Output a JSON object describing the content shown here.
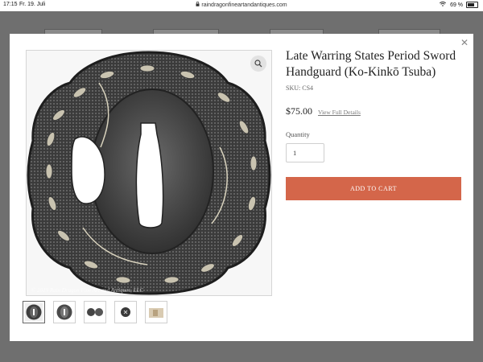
{
  "statusbar": {
    "time": "17:15",
    "date": "Fr. 19. Juli",
    "url": "raindragonfineartandantiques.com",
    "battery": "69 %"
  },
  "product": {
    "title": "Late Warring States Period Sword Handguard (Ko-Kinkō Tsuba)",
    "sku": "SKU: CS4",
    "price": "$75.00",
    "full_details_link": "View Full Details",
    "quantity_label": "Quantity",
    "quantity_value": "1",
    "add_to_cart": "ADD TO CART",
    "watermark": "© 2019 Rain Dragon Fine Art and Antiques, LLC"
  },
  "colors": {
    "accent": "#d4664a",
    "overlay": "#7d7d7d"
  },
  "icons": {
    "close": "close-icon",
    "zoom": "magnifier-icon",
    "lock": "lock-icon",
    "wifi": "wifi-icon",
    "battery": "battery-icon"
  },
  "thumbnails": [
    "tsuba-front",
    "tsuba-back",
    "tsuba-pair",
    "tsuba-detail",
    "tsuba-box"
  ]
}
